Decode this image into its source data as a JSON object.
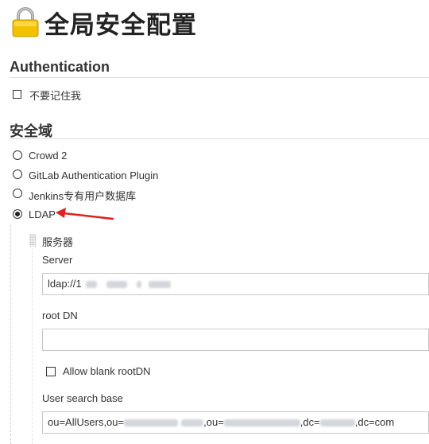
{
  "page": {
    "title": "全局安全配置",
    "icon": "padlock-icon"
  },
  "authentication": {
    "heading": "Authentication",
    "remember_me_label": "不要记住我",
    "remember_me_checked": false
  },
  "security_realm": {
    "heading": "安全域",
    "options": [
      {
        "label": "Crowd 2",
        "checked": false
      },
      {
        "label": "GitLab Authentication Plugin",
        "checked": false
      },
      {
        "label": "Jenkins专有用户数据库",
        "checked": false
      },
      {
        "label": "LDAP",
        "checked": true
      }
    ],
    "annotation_arrow_color": "#e02020"
  },
  "ldap": {
    "server_group_label": "服务器",
    "server_label": "Server",
    "server_value_prefix": "ldap://1",
    "root_dn_label": "root DN",
    "root_dn_value": "",
    "allow_blank_label": "Allow blank rootDN",
    "allow_blank_checked": false,
    "user_search_base_label": "User search base",
    "user_search_base": {
      "part1": "ou=AllUsers,ou=",
      "part2": ",ou=",
      "part3": ",dc=",
      "part4": ",dc=com"
    }
  },
  "colors": {
    "accent_red": "#e02020",
    "divider": "#dcdcdc"
  }
}
